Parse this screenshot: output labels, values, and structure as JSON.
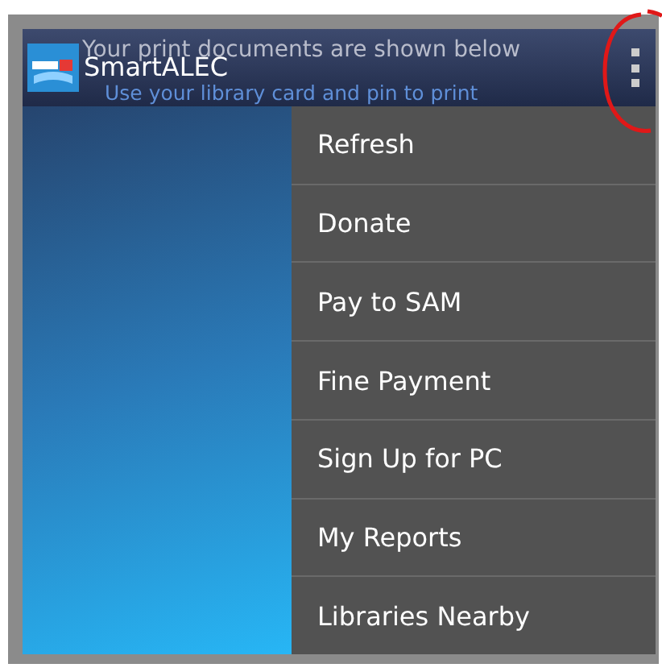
{
  "app_bar": {
    "title": "SmartALEC",
    "message": "Your print documents are shown below",
    "hint": "Use your library card and pin to print"
  },
  "menu": {
    "items": [
      {
        "label": "Refresh"
      },
      {
        "label": "Donate"
      },
      {
        "label": "Pay to SAM"
      },
      {
        "label": "Fine Payment"
      },
      {
        "label": "Sign Up for PC"
      },
      {
        "label": "My Reports"
      },
      {
        "label": "Libraries Nearby"
      }
    ]
  }
}
